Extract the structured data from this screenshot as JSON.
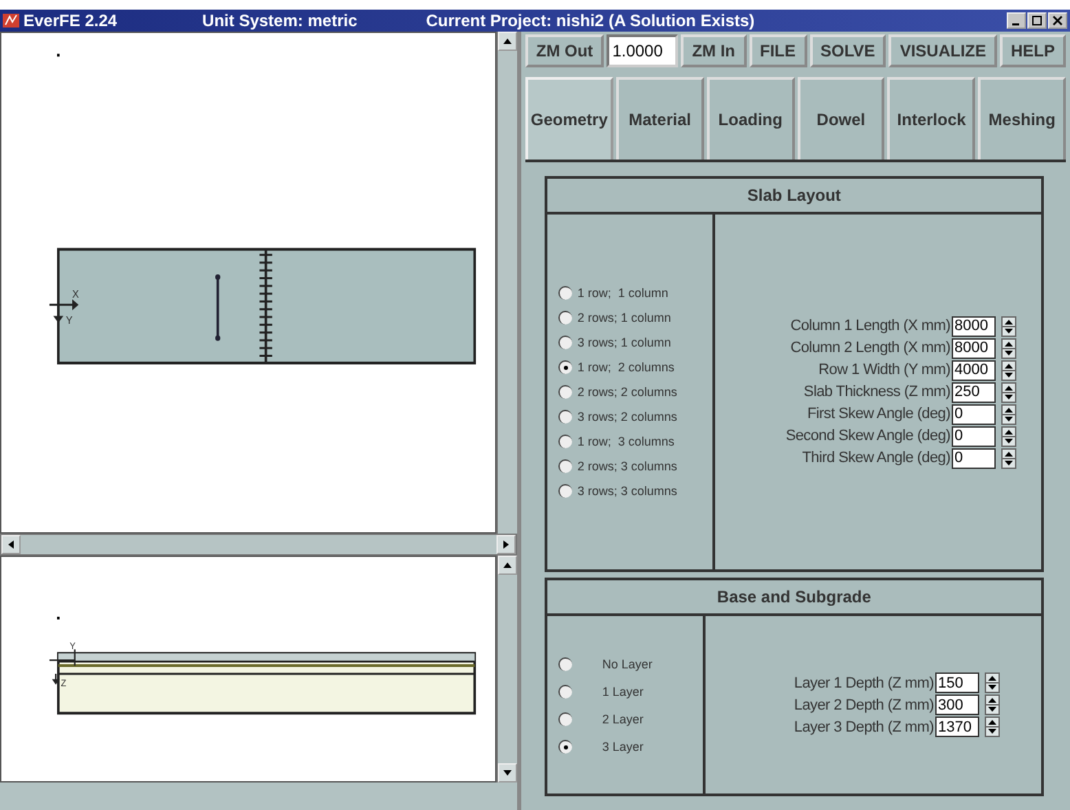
{
  "window": {
    "title": "EverFE 2.24",
    "unit_system": "Unit System: metric",
    "project": "Current Project: nishi2 (A Solution Exists)"
  },
  "plan_view": {
    "axis_labels": [
      "X",
      "Y"
    ]
  },
  "elevation_view": {
    "axis_labels": [
      "Y",
      "Z"
    ]
  },
  "toolbar": {
    "zoom_out": "ZM Out",
    "zoom_value": "1.0000",
    "zoom_in": "ZM In",
    "buttons": [
      "FILE",
      "SOLVE",
      "VISUALIZE",
      "HELP"
    ]
  },
  "tabs": [
    {
      "label": "Geometry",
      "selected": true
    },
    {
      "label": "Material",
      "selected": false
    },
    {
      "label": "Loading",
      "selected": false
    },
    {
      "label": "Dowel",
      "selected": false
    },
    {
      "label": "Interlock",
      "selected": false
    },
    {
      "label": "Meshing",
      "selected": false
    }
  ],
  "slab_layout": {
    "title": "Slab Layout",
    "options": [
      {
        "label": "1 row;  1 column",
        "selected": false
      },
      {
        "label": "2 rows; 1 column",
        "selected": false
      },
      {
        "label": "3 rows; 1 column",
        "selected": false
      },
      {
        "label": "1 row;  2 columns",
        "selected": true
      },
      {
        "label": "2 rows; 2 columns",
        "selected": false
      },
      {
        "label": "3 rows; 2 columns",
        "selected": false
      },
      {
        "label": "1 row;  3 columns",
        "selected": false
      },
      {
        "label": "2 rows; 3 columns",
        "selected": false
      },
      {
        "label": "3 rows; 3 columns",
        "selected": false
      }
    ],
    "fields": [
      {
        "label": "Column 1 Length (X mm)",
        "value": "8000"
      },
      {
        "label": "Column 2 Length (X mm)",
        "value": "8000"
      },
      {
        "label": "Row 1 Width (Y mm)",
        "value": "4000"
      },
      {
        "label": "Slab Thickness (Z mm)",
        "value": "250"
      },
      {
        "label": "First Skew Angle (deg)",
        "value": "0"
      },
      {
        "label": "Second Skew Angle (deg)",
        "value": "0"
      },
      {
        "label": "Third Skew Angle (deg)",
        "value": "0"
      }
    ]
  },
  "base_subgrade": {
    "title": "Base and Subgrade",
    "options": [
      {
        "label": "No Layer",
        "selected": false
      },
      {
        "label": "1 Layer",
        "selected": false
      },
      {
        "label": "2 Layer",
        "selected": false
      },
      {
        "label": "3 Layer",
        "selected": true
      }
    ],
    "fields": [
      {
        "label": "Layer 1 Depth (Z mm)",
        "value": "150"
      },
      {
        "label": "Layer 2 Depth (Z mm)",
        "value": "300"
      },
      {
        "label": "Layer 3 Depth (Z mm)",
        "value": "1370"
      }
    ]
  }
}
